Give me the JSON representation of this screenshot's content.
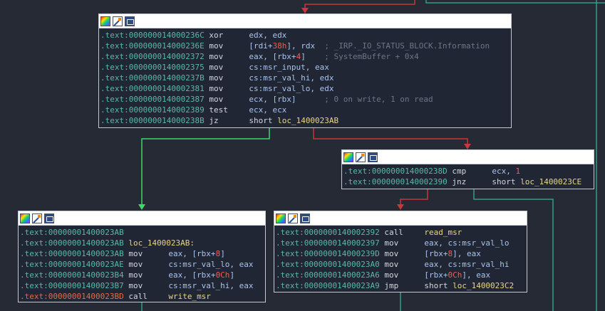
{
  "colors": {
    "edge_red": "#c8373a",
    "edge_green": "#3fd66a",
    "edge_teal": "#2f9e86"
  },
  "header_icons": [
    "color-palette-icon",
    "edit-pencil-icon",
    "graph-overview-icon"
  ],
  "blocks": {
    "b1": {
      "lines": [
        {
          "addr": ".text:000000014000236C",
          "mn": "xor",
          "ops": [
            {
              "t": "edx, edx",
              "c": "op"
            }
          ]
        },
        {
          "addr": ".text:000000014000236E",
          "mn": "mov",
          "ops": [
            {
              "t": "[rdi+",
              "c": "op"
            },
            {
              "t": "38h",
              "c": "num"
            },
            {
              "t": "], rdx",
              "c": "op"
            },
            {
              "t": "  ; _IRP._IO_STATUS_BLOCK.Information",
              "c": "cmt"
            }
          ]
        },
        {
          "addr": ".text:0000000140002372",
          "mn": "mov",
          "ops": [
            {
              "t": "eax, [rbx+",
              "c": "op"
            },
            {
              "t": "4",
              "c": "num"
            },
            {
              "t": "]",
              "c": "op"
            },
            {
              "t": "    ; SystemBuffer + 0x4",
              "c": "cmt"
            }
          ]
        },
        {
          "addr": ".text:0000000140002375",
          "mn": "mov",
          "ops": [
            {
              "t": "cs:msr_input, eax",
              "c": "op"
            }
          ]
        },
        {
          "addr": ".text:000000014000237B",
          "mn": "mov",
          "ops": [
            {
              "t": "cs:msr_val_hi, edx",
              "c": "op"
            }
          ]
        },
        {
          "addr": ".text:0000000140002381",
          "mn": "mov",
          "ops": [
            {
              "t": "cs:msr_val_lo, edx",
              "c": "op"
            }
          ]
        },
        {
          "addr": ".text:0000000140002387",
          "mn": "mov",
          "ops": [
            {
              "t": "ecx, [rbx]",
              "c": "op"
            },
            {
              "t": "      ; 0 on write, 1 on read",
              "c": "cmt"
            }
          ]
        },
        {
          "addr": ".text:0000000140002389",
          "mn": "test",
          "ops": [
            {
              "t": "ecx, ecx",
              "c": "op"
            }
          ]
        },
        {
          "addr": ".text:000000014000238B",
          "mn": "jz",
          "ops": [
            {
              "t": "short ",
              "c": "plain"
            },
            {
              "t": "loc_1400023AB",
              "c": "lbl"
            }
          ]
        }
      ]
    },
    "b2": {
      "lines": [
        {
          "addr": ".text:000000014000238D",
          "mn": "cmp",
          "ops": [
            {
              "t": "ecx, ",
              "c": "op"
            },
            {
              "t": "1",
              "c": "num"
            }
          ]
        },
        {
          "addr": ".text:0000000140002390",
          "mn": "jnz",
          "ops": [
            {
              "t": "short ",
              "c": "plain"
            },
            {
              "t": "loc_1400023CE",
              "c": "lbl"
            }
          ]
        }
      ]
    },
    "b3": {
      "lines": [
        {
          "addr": ".text:00000001400023AB",
          "mn": "",
          "ops": []
        },
        {
          "addr": ".text:00000001400023AB",
          "mn": "",
          "ops": [
            {
              "t": "loc_1400023AB:",
              "c": "lbl"
            }
          ]
        },
        {
          "addr": ".text:00000001400023AB",
          "mn": "mov",
          "ops": [
            {
              "t": "eax, [rbx+",
              "c": "op"
            },
            {
              "t": "8",
              "c": "num"
            },
            {
              "t": "]",
              "c": "op"
            }
          ]
        },
        {
          "addr": ".text:00000001400023AE",
          "mn": "mov",
          "ops": [
            {
              "t": "cs:msr_val_lo, eax",
              "c": "op"
            }
          ]
        },
        {
          "addr": ".text:00000001400023B4",
          "mn": "mov",
          "ops": [
            {
              "t": "eax, [rbx+",
              "c": "op"
            },
            {
              "t": "0Ch",
              "c": "num"
            },
            {
              "t": "]",
              "c": "op"
            }
          ]
        },
        {
          "addr": ".text:00000001400023B7",
          "mn": "mov",
          "ops": [
            {
              "t": "cs:msr_val_hi, eax",
              "c": "op"
            }
          ]
        },
        {
          "addr": ".text:00000001400023BD",
          "mn": "call",
          "ops": [
            {
              "t": "write_msr",
              "c": "lbl"
            }
          ],
          "addr_red": true
        }
      ]
    },
    "b4": {
      "lines": [
        {
          "addr": ".text:0000000140002392",
          "mn": "call",
          "ops": [
            {
              "t": "read_msr",
              "c": "lbl"
            }
          ]
        },
        {
          "addr": ".text:0000000140002397",
          "mn": "mov",
          "ops": [
            {
              "t": "eax, cs:msr_val_lo",
              "c": "op"
            }
          ]
        },
        {
          "addr": ".text:000000014000239D",
          "mn": "mov",
          "ops": [
            {
              "t": "[rbx+",
              "c": "op"
            },
            {
              "t": "8",
              "c": "num"
            },
            {
              "t": "], eax",
              "c": "op"
            }
          ]
        },
        {
          "addr": ".text:00000001400023A0",
          "mn": "mov",
          "ops": [
            {
              "t": "eax, cs:msr_val_hi",
              "c": "op"
            }
          ]
        },
        {
          "addr": ".text:00000001400023A6",
          "mn": "mov",
          "ops": [
            {
              "t": "[rbx+",
              "c": "op"
            },
            {
              "t": "0Ch",
              "c": "num"
            },
            {
              "t": "], eax",
              "c": "op"
            }
          ]
        },
        {
          "addr": ".text:00000001400023A9",
          "mn": "jmp",
          "ops": [
            {
              "t": "short ",
              "c": "plain"
            },
            {
              "t": "loc_1400023C2",
              "c": "lbl"
            }
          ]
        }
      ]
    }
  }
}
